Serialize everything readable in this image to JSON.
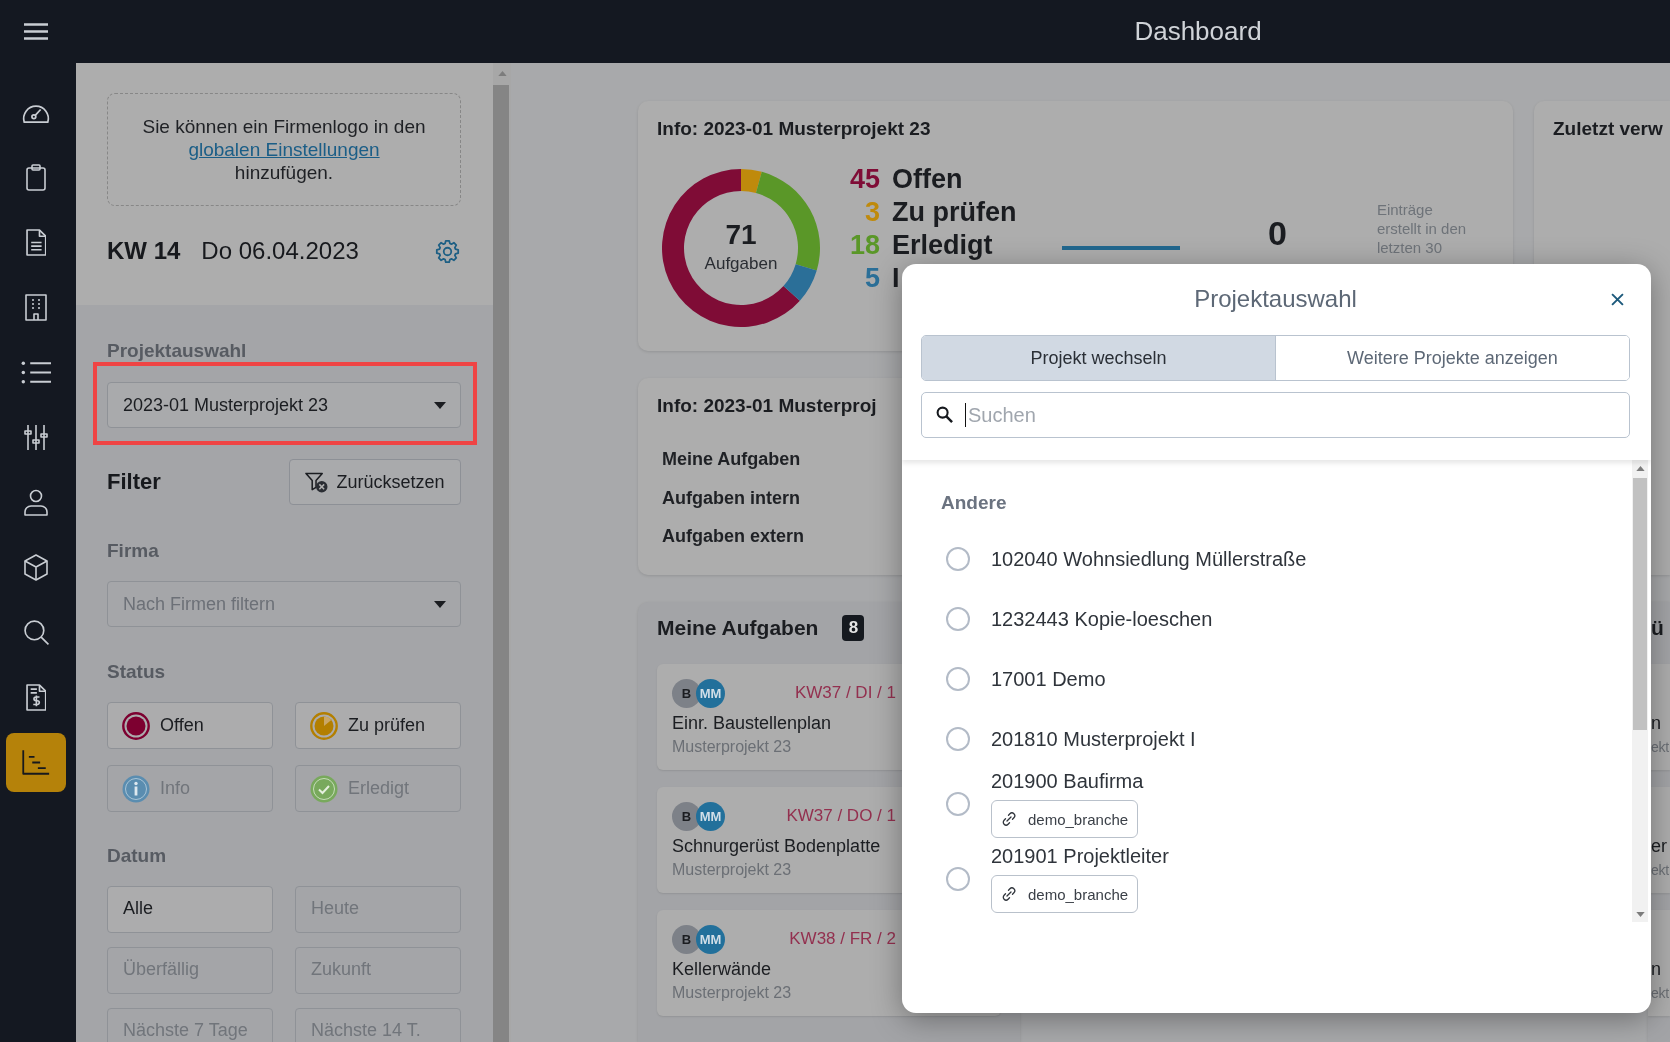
{
  "top_bar": {
    "title": "Dashboard"
  },
  "nav_rail": {
    "items": [
      {
        "selected": false
      },
      {
        "selected": false
      },
      {
        "selected": false
      },
      {
        "selected": false
      },
      {
        "selected": false
      },
      {
        "selected": false
      },
      {
        "selected": false
      },
      {
        "selected": false
      },
      {
        "selected": false
      },
      {
        "selected": false
      },
      {
        "selected": true
      }
    ]
  },
  "sidebar": {
    "logo_hint": {
      "text_before": "Sie können ein Firmenlogo in den",
      "link": "globalen Einstellungen",
      "text_after": "hinzufügen."
    },
    "week": "KW 14",
    "date": "Do 06.04.2023",
    "project_select": {
      "label": "Projektauswahl",
      "value": "2023-01 Musterprojekt 23",
      "highlighted": true
    },
    "filter": {
      "title": "Filter",
      "reset_button": "Zurücksetzen"
    },
    "company": {
      "label": "Firma",
      "placeholder": "Nach Firmen filtern"
    },
    "status": {
      "label": "Status",
      "options": [
        {
          "label": "Offen",
          "kind": "open",
          "color": "#7d0030",
          "selected": true
        },
        {
          "label": "Zu prüfen",
          "kind": "review",
          "color": "#b37f00",
          "selected": true
        },
        {
          "label": "Info",
          "kind": "info",
          "color": "#5a8db0",
          "selected": false
        },
        {
          "label": "Erledigt",
          "kind": "done",
          "color": "#78a95c",
          "selected": false
        }
      ]
    },
    "date_filter": {
      "label": "Datum",
      "options": [
        {
          "label": "Alle",
          "selected": true
        },
        {
          "label": "Heute",
          "selected": false
        },
        {
          "label": "Überfällig",
          "selected": false
        },
        {
          "label": "Zukunft",
          "selected": false
        },
        {
          "label": "Nächste 7 Tage",
          "selected": false
        },
        {
          "label": "Nächste 14 T.",
          "selected": false
        }
      ]
    }
  },
  "dashboard": {
    "project_info": {
      "title": "Info: 2023-01 Musterprojekt 23",
      "chart_data": {
        "type": "donut",
        "categories": [
          "Offen",
          "Zu prüfen",
          "Erledigt",
          "I"
        ],
        "values": [
          63.38,
          4.23,
          25.35,
          7.04
        ]
      },
      "legend": [
        {
          "count": "45",
          "color": "#7f0c36"
        },
        {
          "count": "3",
          "color": "#bf8a0c"
        },
        {
          "count": "18",
          "color": "#5a9728"
        },
        {
          "count": "5",
          "color": "#2b6f98"
        }
      ],
      "center_value": "71",
      "center_label": "Aufgaben",
      "entries_count": "0",
      "entries_note": "Einträge erstellt in den letzten 30"
    },
    "recent": {
      "title": "Zuletzt verw"
    },
    "project_links": {
      "title": "Info: 2023-01 Musterproj",
      "links": [
        "Meine Aufgaben",
        "Aufgaben intern",
        "Aufgaben extern"
      ]
    },
    "my_tasks": {
      "title": "Meine Aufgaben",
      "count": "8",
      "tasks": [
        {
          "avatars": [
            {
              "initials": "B",
              "color": "#7d8188"
            },
            {
              "initials": "MM",
              "color": "#22709b"
            }
          ],
          "due": "KW37 / DI / 1",
          "title": "Einr. Baustellenplan",
          "project": "Musterprojekt 23"
        },
        {
          "avatars": [
            {
              "initials": "B",
              "color": "#7d8188"
            },
            {
              "initials": "MM",
              "color": "#22709b"
            }
          ],
          "due": "KW37 / DO / 1",
          "title": "Schnurgerüst Bodenplatte",
          "project": "Musterprojekt 23"
        },
        {
          "avatars": [
            {
              "initials": "B",
              "color": "#7d8188"
            },
            {
              "initials": "MM",
              "color": "#22709b"
            }
          ],
          "due": "KW38 / FR / 2",
          "title": "Kellerwände",
          "project": "Musterprojekt 23"
        }
      ]
    },
    "column_3": {
      "title": "ü",
      "tasks": [
        {
          "title": "n",
          "project": "ekt"
        },
        {
          "title": "er",
          "project": "ekt"
        },
        {
          "title": "n",
          "project": "ekt"
        }
      ]
    }
  },
  "modal": {
    "title": "Projektauswahl",
    "tabs": [
      {
        "label": "Projekt wechseln",
        "selected": true
      },
      {
        "label": "Weitere Projekte anzeigen",
        "selected": false
      }
    ],
    "search": {
      "placeholder": "Suchen"
    },
    "group_label": "Andere",
    "projects": [
      {
        "name": "102040 Wohnsiedlung Müllerstraße",
        "selected": false
      },
      {
        "name": "1232443 Kopie-loeschen",
        "selected": false
      },
      {
        "name": "17001 Demo",
        "selected": false
      },
      {
        "name": "201810 Musterprojekt I",
        "selected": false
      },
      {
        "name": "201900 Baufirma",
        "tag": "demo_branche",
        "selected": false
      },
      {
        "name": "201901 Projektleiter",
        "tag": "demo_branche",
        "selected": false
      }
    ]
  }
}
